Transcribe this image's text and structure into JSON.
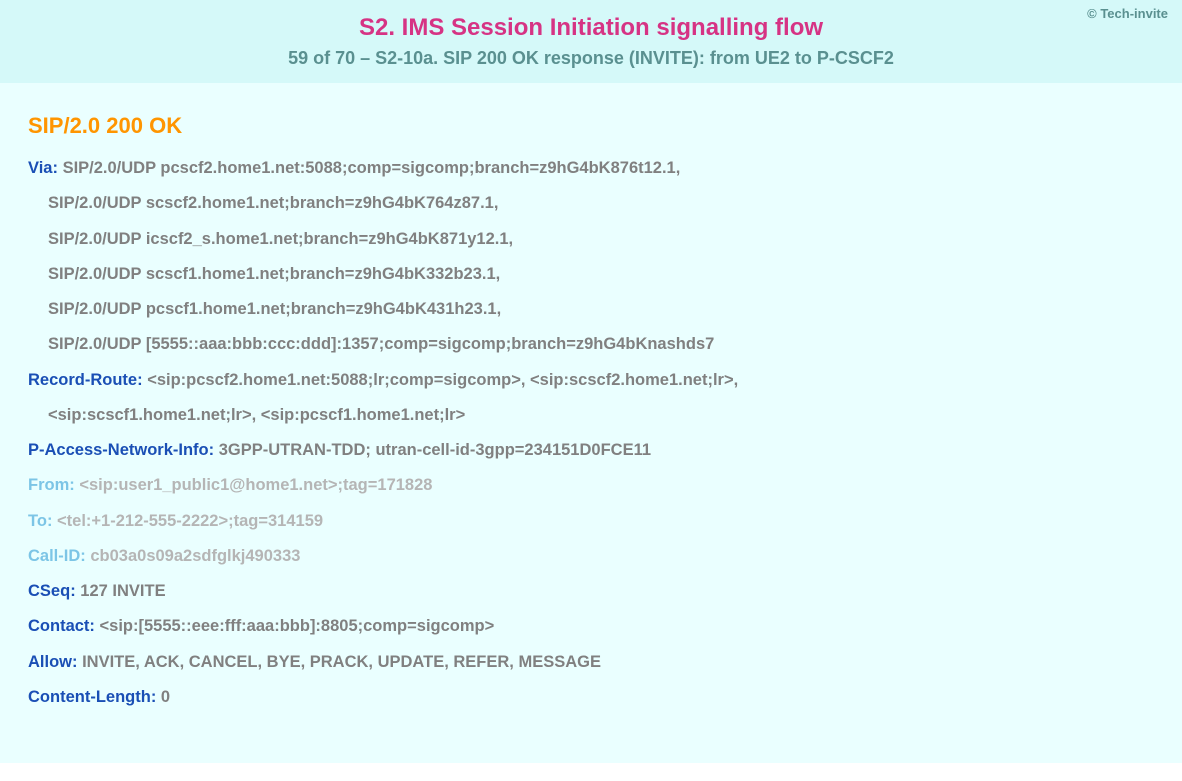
{
  "header": {
    "copyright": "© Tech-invite",
    "title": "S2. IMS Session Initiation signalling flow",
    "subtitle": "59 of 70 – S2-10a. SIP 200 OK response (INVITE): from UE2 to P-CSCF2"
  },
  "sip": {
    "status": "SIP/2.0 200 OK",
    "via": {
      "label": "Via",
      "line1": "SIP/2.0/UDP pcscf2.home1.net:5088;comp=sigcomp;branch=z9hG4bK876t12.1,",
      "line2": "SIP/2.0/UDP scscf2.home1.net;branch=z9hG4bK764z87.1,",
      "line3": "SIP/2.0/UDP icscf2_s.home1.net;branch=z9hG4bK871y12.1,",
      "line4": "SIP/2.0/UDP scscf1.home1.net;branch=z9hG4bK332b23.1,",
      "line5": "SIP/2.0/UDP pcscf1.home1.net;branch=z9hG4bK431h23.1,",
      "line6": "SIP/2.0/UDP [5555::aaa:bbb:ccc:ddd]:1357;comp=sigcomp;branch=z9hG4bKnashds7"
    },
    "recordRoute": {
      "label": "Record-Route",
      "line1": "<sip:pcscf2.home1.net:5088;lr;comp=sigcomp>, <sip:scscf2.home1.net;lr>,",
      "line2": "<sip:scscf1.home1.net;lr>, <sip:pcscf1.home1.net;lr>"
    },
    "pAccessNetworkInfo": {
      "label": "P-Access-Network-Info",
      "value": "3GPP-UTRAN-TDD; utran-cell-id-3gpp=234151D0FCE11"
    },
    "from": {
      "label": "From",
      "value": "<sip:user1_public1@home1.net>;tag=171828"
    },
    "to": {
      "label": "To",
      "value": "<tel:+1-212-555-2222>;tag=314159"
    },
    "callId": {
      "label": "Call-ID",
      "value": "cb03a0s09a2sdfglkj490333"
    },
    "cseq": {
      "label": "CSeq",
      "value": "127 INVITE"
    },
    "contact": {
      "label": "Contact",
      "value": "<sip:[5555::eee:fff:aaa:bbb]:8805;comp=sigcomp>"
    },
    "allow": {
      "label": "Allow",
      "value": "INVITE, ACK, CANCEL, BYE, PRACK, UPDATE, REFER, MESSAGE"
    },
    "contentLength": {
      "label": "Content-Length",
      "value": "0"
    }
  }
}
